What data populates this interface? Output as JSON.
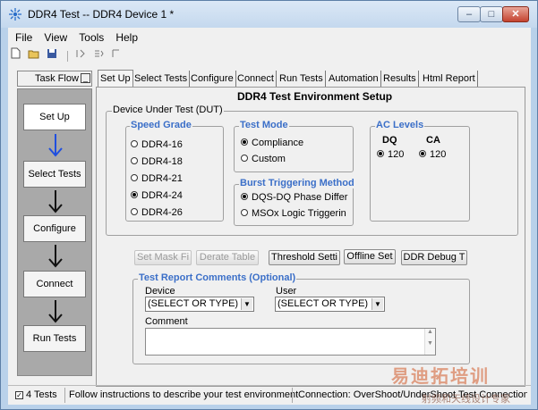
{
  "window": {
    "title": "DDR4 Test -- DDR4 Device 1 *",
    "min_label": "–",
    "max_label": "□",
    "close_label": "✕"
  },
  "menu": [
    "File",
    "View",
    "Tools",
    "Help"
  ],
  "taskflow": {
    "header": "Task Flow",
    "steps": [
      "Set Up",
      "Select Tests",
      "Configure",
      "Connect",
      "Run Tests"
    ],
    "active_step": "Set Up"
  },
  "tabs": [
    "Set Up",
    "Select Tests",
    "Configure",
    "Connect",
    "Run Tests",
    "Automation",
    "Results",
    "Html Report"
  ],
  "active_tab": "Set Up",
  "page": {
    "title": "DDR4 Test Environment Setup",
    "dut_label": "Device Under Test (DUT)",
    "speed_grade": {
      "label": "Speed Grade",
      "options": [
        "DDR4-16",
        "DDR4-18",
        "DDR4-21",
        "DDR4-24",
        "DDR4-26"
      ],
      "selected": "DDR4-24"
    },
    "test_mode": {
      "label": "Test Mode",
      "options": [
        "Compliance",
        "Custom"
      ],
      "selected": "Compliance"
    },
    "burst_triggering": {
      "label": "Burst Triggering Method",
      "options": [
        "DQS-DQ Phase Differ",
        "MSOx Logic Triggerin"
      ],
      "selected": "DQS-DQ Phase Differ"
    },
    "ac_levels": {
      "label": "AC Levels",
      "dq_label": "DQ",
      "ca_label": "CA",
      "dq_value": "120",
      "ca_value": "120"
    },
    "buttons": {
      "set_mask": "Set Mask Fi",
      "derate_table": "Derate Table",
      "threshold": "Threshold Setti",
      "offline": "Offline Set",
      "ddr_debug": "DDR Debug T"
    },
    "comments": {
      "label": "Test Report Comments (Optional)",
      "device_label": "Device",
      "device_value": "(SELECT OR TYPE)",
      "user_label": "User",
      "user_value": "(SELECT OR TYPE)",
      "comment_label": "Comment"
    }
  },
  "status": {
    "tests": "4 Tests",
    "message": "Follow instructions to describe your test environment",
    "connection": "Connection: OverShoot/UnderShoot Test Connection"
  },
  "watermark": {
    "text": "易迪拓培训",
    "subtext": "射频和天线设计专家"
  }
}
